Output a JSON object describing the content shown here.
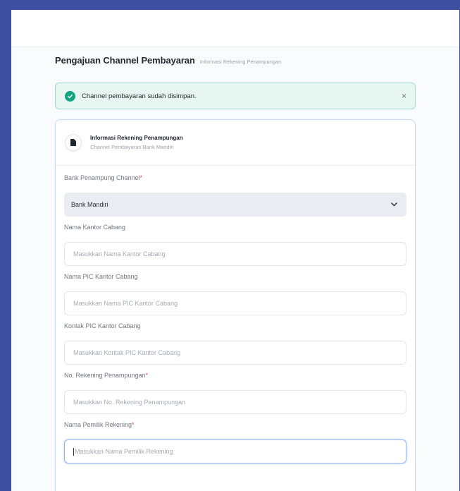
{
  "header": {
    "title": "Pengajuan Channel Pembayaran",
    "subtitle": "Informasi Rekening Penampungan"
  },
  "alert": {
    "message": "Channel pembayaran sudah disimpan.",
    "close": "×",
    "color": "#12a582"
  },
  "card": {
    "title": "Informasi Rekening Penampungan",
    "subtitle": "Channel Pembayaran Bank Mandiri"
  },
  "form": {
    "bank": {
      "label": "Bank Penampung Channel",
      "required": "*",
      "value": "Bank Mandiri"
    },
    "branch_name": {
      "label": "Nama Kantor Cabang",
      "placeholder": "Masukkan Nama Kantor Cabang"
    },
    "pic_name": {
      "label": "Nama PIC Kantor Cabang",
      "placeholder": "Masukkan Nama PIC Kantor Cabang"
    },
    "pic_contact": {
      "label": "Kontak PIC Kantor Cabang",
      "placeholder": "Masukkan Kontak PIC Kantor Cabang"
    },
    "account_no": {
      "label": "No. Rekening Penampungan",
      "required": "*",
      "placeholder": "Masukkan No. Rekening Penampungan"
    },
    "owner_name": {
      "label": "Nama Pemilik Rekening",
      "required": "*",
      "placeholder": "Masukkan Nama Pemilik Rekening"
    }
  },
  "colors": {
    "accent": "#3c4fa0",
    "required": "#e5484d"
  }
}
